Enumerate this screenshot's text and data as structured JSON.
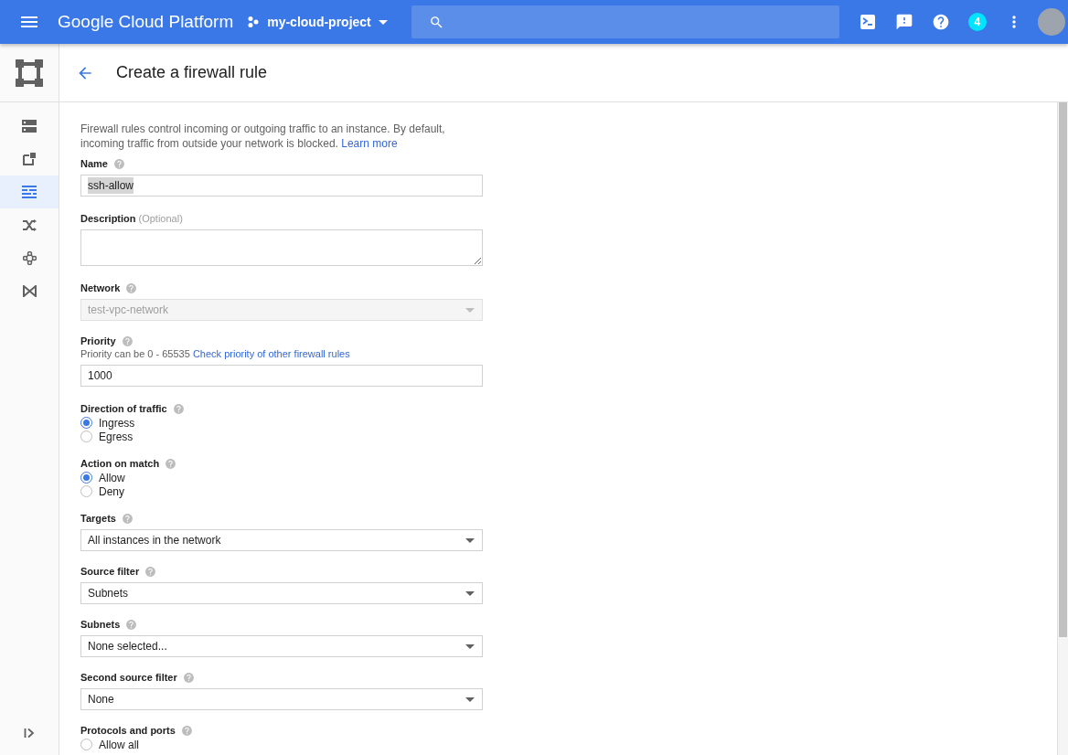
{
  "header": {
    "product": "Google Cloud Platform",
    "project": "my-cloud-project",
    "notification_count": "4"
  },
  "sidebar": {
    "items": [
      {
        "selected": false
      },
      {
        "selected": false
      },
      {
        "selected": true
      },
      {
        "selected": false
      },
      {
        "selected": false
      },
      {
        "selected": false
      }
    ]
  },
  "page": {
    "title": "Create a firewall rule"
  },
  "intro": {
    "text": "Firewall rules control incoming or outgoing traffic to an instance. By default, incoming traffic from outside your network is blocked.",
    "link": "Learn more"
  },
  "fields": [
    {
      "kind": "text",
      "label": "Name",
      "value": "ssh-allow",
      "value_selected": true
    },
    {
      "kind": "textarea",
      "label": "Description",
      "note": "(Optional)"
    },
    {
      "kind": "select",
      "label": "Network",
      "value": "test-vpc-network",
      "disabled": true
    },
    {
      "kind": "text",
      "label": "Priority",
      "hint": "Priority can be 0 - 65535",
      "hint_link": "Check priority of other firewall rules",
      "value": "1000",
      "value_selected": false
    },
    {
      "kind": "radio",
      "label": "Direction of traffic",
      "options": [
        {
          "label": "Ingress",
          "selected": true
        },
        {
          "label": "Egress",
          "selected": false
        }
      ]
    },
    {
      "kind": "radio",
      "label": "Action on match",
      "options": [
        {
          "label": "Allow",
          "selected": true
        },
        {
          "label": "Deny",
          "selected": false
        }
      ]
    },
    {
      "kind": "select",
      "label": "Targets",
      "value": "All instances in the network",
      "disabled": false
    },
    {
      "kind": "select",
      "label": "Source filter",
      "value": "Subnets",
      "disabled": false
    },
    {
      "kind": "select",
      "label": "Subnets",
      "value": "None selected...",
      "disabled": false
    },
    {
      "kind": "select",
      "label": "Second source filter",
      "value": "None",
      "disabled": false
    },
    {
      "kind": "radio",
      "label": "Protocols and ports",
      "options": [
        {
          "label": "Allow all",
          "selected": false
        }
      ]
    }
  ]
}
